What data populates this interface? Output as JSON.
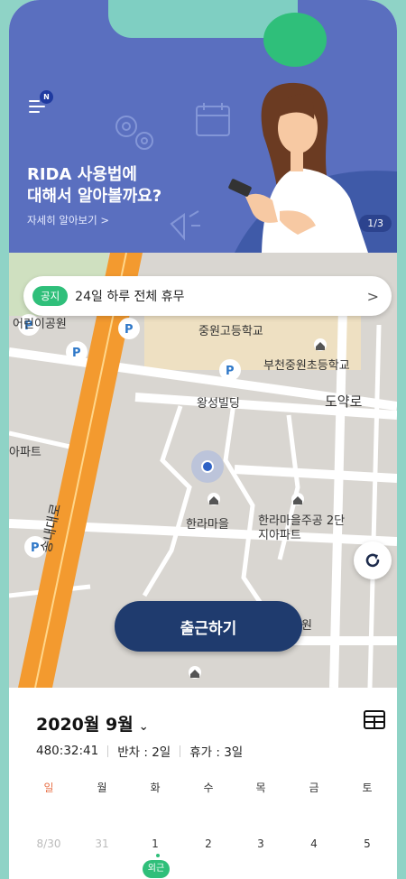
{
  "banner": {
    "title": "RIDA 사용법에\n대해서 알아볼까요?",
    "link": "자세히 알아보기 >",
    "page_indicator": "1/3",
    "menu_badge": "N"
  },
  "notice": {
    "tag": "공지",
    "text": "24일 하루 전체 휴무",
    "chevron": ">"
  },
  "map": {
    "labels": [
      "중원고등학교",
      "부천중원초등학교",
      "왕성빌딩",
      "도약로",
      "한라마을",
      "한라마을주공 2단지아파트",
      "어린이공원",
      "아파트",
      "송내대로",
      "원"
    ]
  },
  "checkin_button": "출근하기",
  "calendar": {
    "month": "2020월 9월",
    "stats": {
      "time": "480:32:41",
      "half_day": "반차 : 2일",
      "vacation": "휴가 : 3일"
    },
    "weekdays": [
      "일",
      "월",
      "화",
      "수",
      "목",
      "금",
      "토"
    ],
    "days": [
      "8/30",
      "31",
      "1",
      "2",
      "3",
      "4",
      "5"
    ],
    "badge": "외근"
  },
  "icons": {
    "menu": "hamburger-menu-icon",
    "calendar": "calendar-icon",
    "refresh": "refresh-icon",
    "month_dropdown": "chevron-down-icon"
  },
  "colors": {
    "banner": "#5a6fbf",
    "accent_green": "#2fbf7a",
    "button_navy": "#1f3b6e",
    "sunday_red": "#e8734a"
  }
}
